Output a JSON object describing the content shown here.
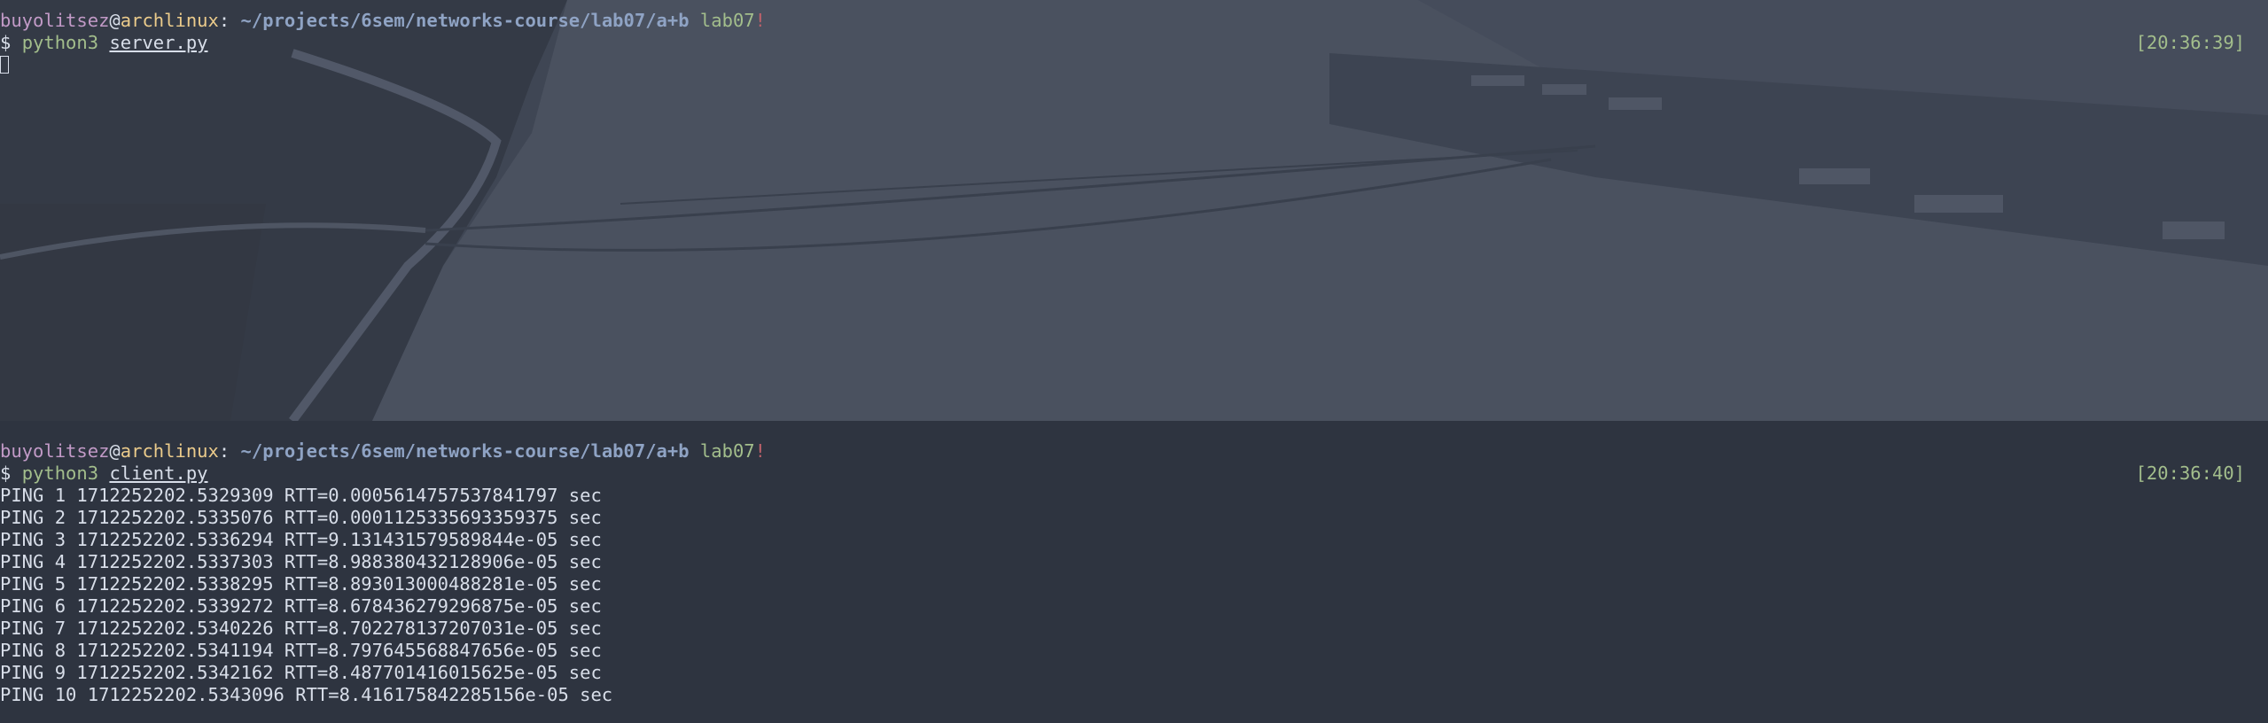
{
  "top_pane": {
    "prompt": {
      "user": "buyolitsez",
      "at": "@",
      "host": "archlinux",
      "colon": ":",
      "path": " ~/projects/6sem/networks-course/lab07/a+b",
      "branch": " lab07",
      "dirty": "!"
    },
    "command": {
      "dollar": "$ ",
      "program": "python3",
      "space": " ",
      "arg": "server.py"
    },
    "timestamp": "[20:36:39]",
    "background_image": "snowy-landscape-aerial-photo"
  },
  "bottom_pane": {
    "prompt": {
      "user": "buyolitsez",
      "at": "@",
      "host": "archlinux",
      "colon": ":",
      "path": " ~/projects/6sem/networks-course/lab07/a+b",
      "branch": " lab07",
      "dirty": "!"
    },
    "command": {
      "dollar": "$ ",
      "program": "python3",
      "space": " ",
      "arg": "client.py"
    },
    "timestamp": "[20:36:40]",
    "output": [
      "PING 1 1712252202.5329309 RTT=0.0005614757537841797 sec",
      "PING 2 1712252202.5335076 RTT=0.0001125335693359375 sec",
      "PING 3 1712252202.5336294 RTT=9.131431579589844e-05 sec",
      "PING 4 1712252202.5337303 RTT=8.988380432128906e-05 sec",
      "PING 5 1712252202.5338295 RTT=8.893013000488281e-05 sec",
      "PING 6 1712252202.5339272 RTT=8.678436279296875e-05 sec",
      "PING 7 1712252202.5340226 RTT=8.702278137207031e-05 sec",
      "PING 8 1712252202.5341194 RTT=8.797645568847656e-05 sec",
      "PING 9 1712252202.5342162 RTT=8.487701416015625e-05 sec",
      "PING 10 1712252202.5343096 RTT=8.416175842285156e-05 sec"
    ]
  }
}
